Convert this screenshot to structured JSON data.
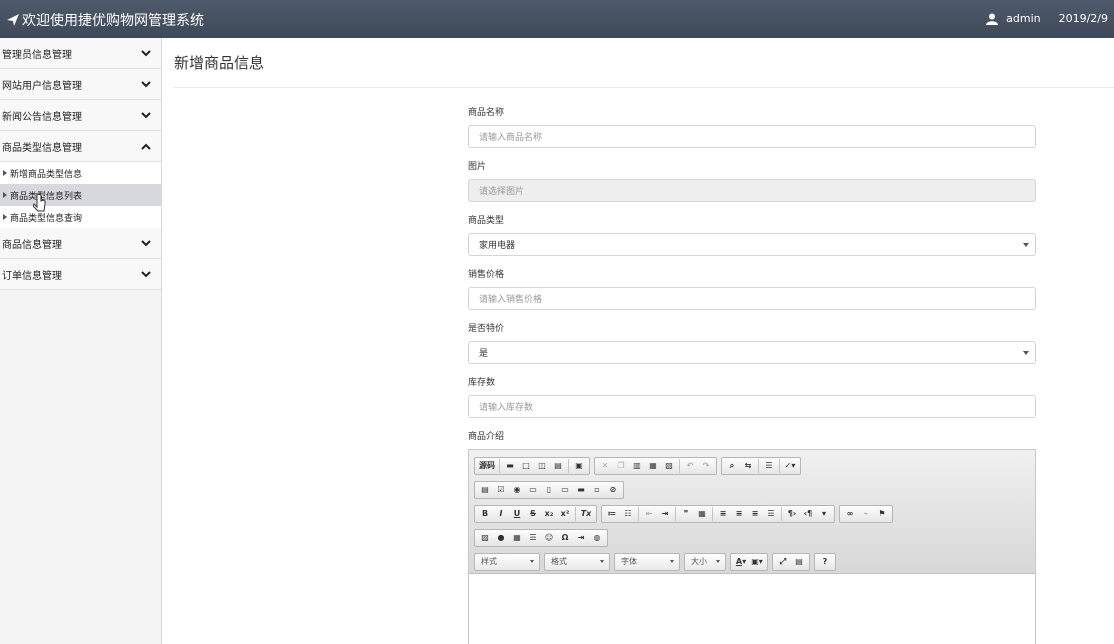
{
  "header": {
    "title": "欢迎使用捷优购物网管理系统",
    "user": "admin",
    "date": "2019/2/9"
  },
  "sidebar": {
    "menus": [
      {
        "label": "管理员信息管理"
      },
      {
        "label": "网站用户信息管理"
      },
      {
        "label": "新闻公告信息管理"
      },
      {
        "label": "商品类型信息管理"
      }
    ],
    "submenu": [
      {
        "label": "新增商品类型信息"
      },
      {
        "label": "商品类型信息列表"
      },
      {
        "label": "商品类型信息查询"
      }
    ],
    "menus_after": [
      {
        "label": "商品信息管理"
      },
      {
        "label": "订单信息管理"
      }
    ]
  },
  "main": {
    "title": "新增商品信息",
    "fields": {
      "name": {
        "label": "商品名称",
        "placeholder": "请输入商品名称"
      },
      "image": {
        "label": "图片",
        "placeholder": "请选择图片"
      },
      "type": {
        "label": "商品类型",
        "value": "家用电器"
      },
      "price": {
        "label": "销售价格",
        "placeholder": "请输入销售价格"
      },
      "special": {
        "label": "是否特价",
        "value": "是"
      },
      "stock": {
        "label": "库存数",
        "placeholder": "请输入库存数"
      },
      "intro": {
        "label": "商品介绍"
      }
    },
    "editor": {
      "source_label": "源码",
      "styles_label": "样式",
      "format_label": "格式",
      "font_label": "字体",
      "size_label": "大小"
    }
  },
  "colors": {
    "topbar": "#45505f",
    "active_submenu": "#d7d7de"
  }
}
